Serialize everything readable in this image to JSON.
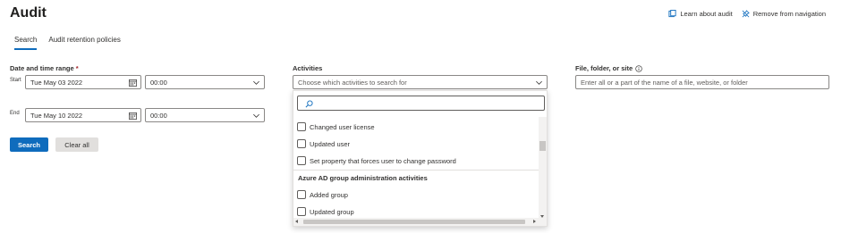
{
  "page": {
    "title": "Audit"
  },
  "top_links": {
    "learn": "Learn about audit",
    "remove": "Remove from navigation"
  },
  "tabs": [
    {
      "label": "Search",
      "active": true
    },
    {
      "label": "Audit retention policies",
      "active": false
    }
  ],
  "date_range": {
    "label": "Date and time range",
    "required_mark": "*",
    "start": {
      "label": "Start",
      "date": "Tue May 03 2022",
      "time": "00:00"
    },
    "end": {
      "label": "End",
      "date": "Tue May 10 2022",
      "time": "00:00"
    }
  },
  "activities": {
    "label": "Activities",
    "placeholder": "Choose which activities to search for",
    "search_value": "",
    "items": [
      {
        "label": "Changed user license",
        "checked": false
      },
      {
        "label": "Updated user",
        "checked": false
      },
      {
        "label": "Set property that forces user to change password",
        "checked": false
      }
    ],
    "group": {
      "title": "Azure AD group administration activities",
      "items": [
        {
          "label": "Added group",
          "checked": false
        },
        {
          "label": "Updated group",
          "checked": false
        }
      ]
    }
  },
  "file_filter": {
    "label": "File, folder, or site",
    "placeholder": "Enter all or a part of the name of a file, website, or folder"
  },
  "buttons": {
    "search": "Search",
    "clear": "Clear all"
  },
  "colors": {
    "accent": "#0f6cbd",
    "required": "#a4262c",
    "secondary_button": "#e1dfdd"
  },
  "icons": [
    "learn-icon",
    "unpin-icon",
    "info-icon",
    "calendar-icon",
    "chevron-down-icon",
    "search-icon"
  ]
}
